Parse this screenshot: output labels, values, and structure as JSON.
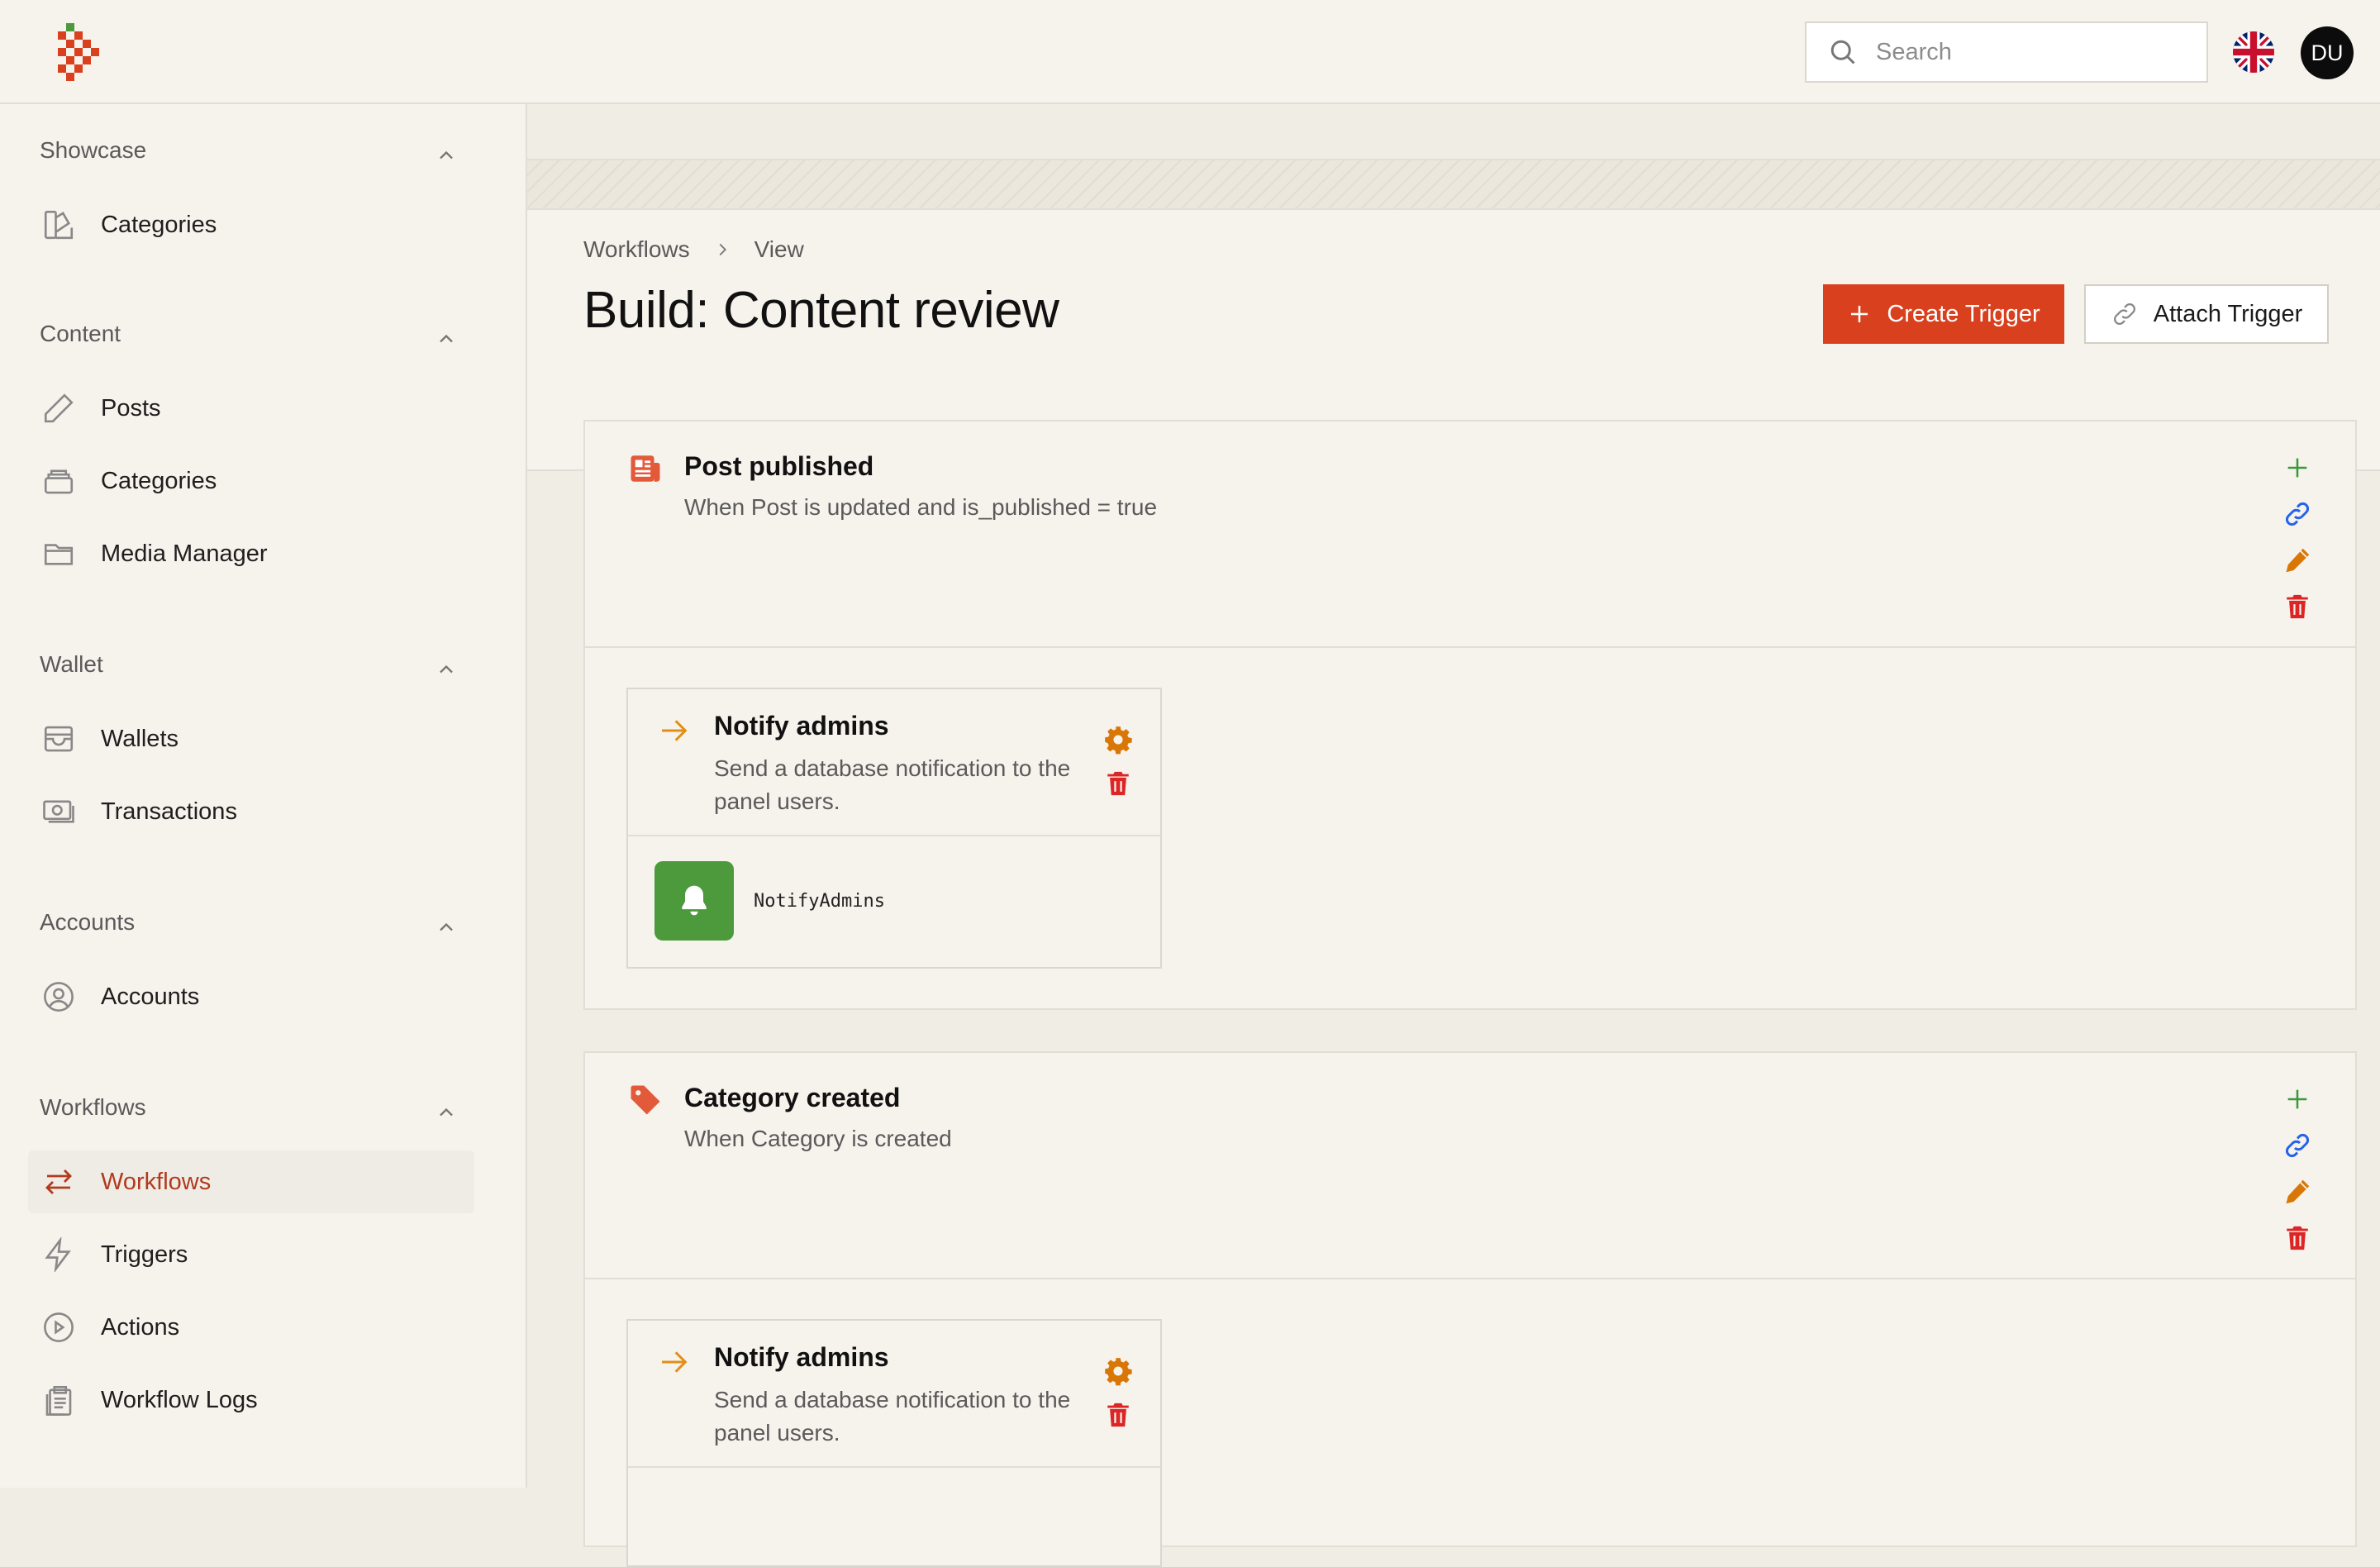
{
  "topbar": {
    "search_placeholder": "Search",
    "avatar_initials": "DU"
  },
  "sidebar": {
    "groups": [
      {
        "label": "Showcase",
        "items": [
          {
            "label": "Categories"
          }
        ]
      },
      {
        "label": "Content",
        "items": [
          {
            "label": "Posts"
          },
          {
            "label": "Categories"
          },
          {
            "label": "Media Manager"
          }
        ]
      },
      {
        "label": "Wallet",
        "items": [
          {
            "label": "Wallets"
          },
          {
            "label": "Transactions"
          }
        ]
      },
      {
        "label": "Accounts",
        "items": [
          {
            "label": "Accounts"
          }
        ]
      },
      {
        "label": "Workflows",
        "items": [
          {
            "label": "Workflows",
            "active": true
          },
          {
            "label": "Triggers"
          },
          {
            "label": "Actions"
          },
          {
            "label": "Workflow Logs"
          }
        ]
      }
    ]
  },
  "breadcrumb": {
    "parent": "Workflows",
    "current": "View"
  },
  "page": {
    "title": "Build: Content review",
    "create_trigger": "Create Trigger",
    "attach_trigger": "Attach Trigger"
  },
  "triggers": [
    {
      "title": "Post published",
      "subtitle": "When Post is updated and is_published = true",
      "action": {
        "title": "Notify admins",
        "description": "Send a database notification to the panel users.",
        "step": "NotifyAdmins"
      }
    },
    {
      "title": "Category created",
      "subtitle": "When Category is created",
      "action": {
        "title": "Notify admins",
        "description": "Send a database notification to the panel users."
      }
    }
  ],
  "colors": {
    "primary": "#d9411e",
    "add": "#3a9a3a",
    "link": "#2563eb",
    "edit": "#d97706",
    "delete": "#dc2626",
    "step": "#4c9a3c"
  }
}
